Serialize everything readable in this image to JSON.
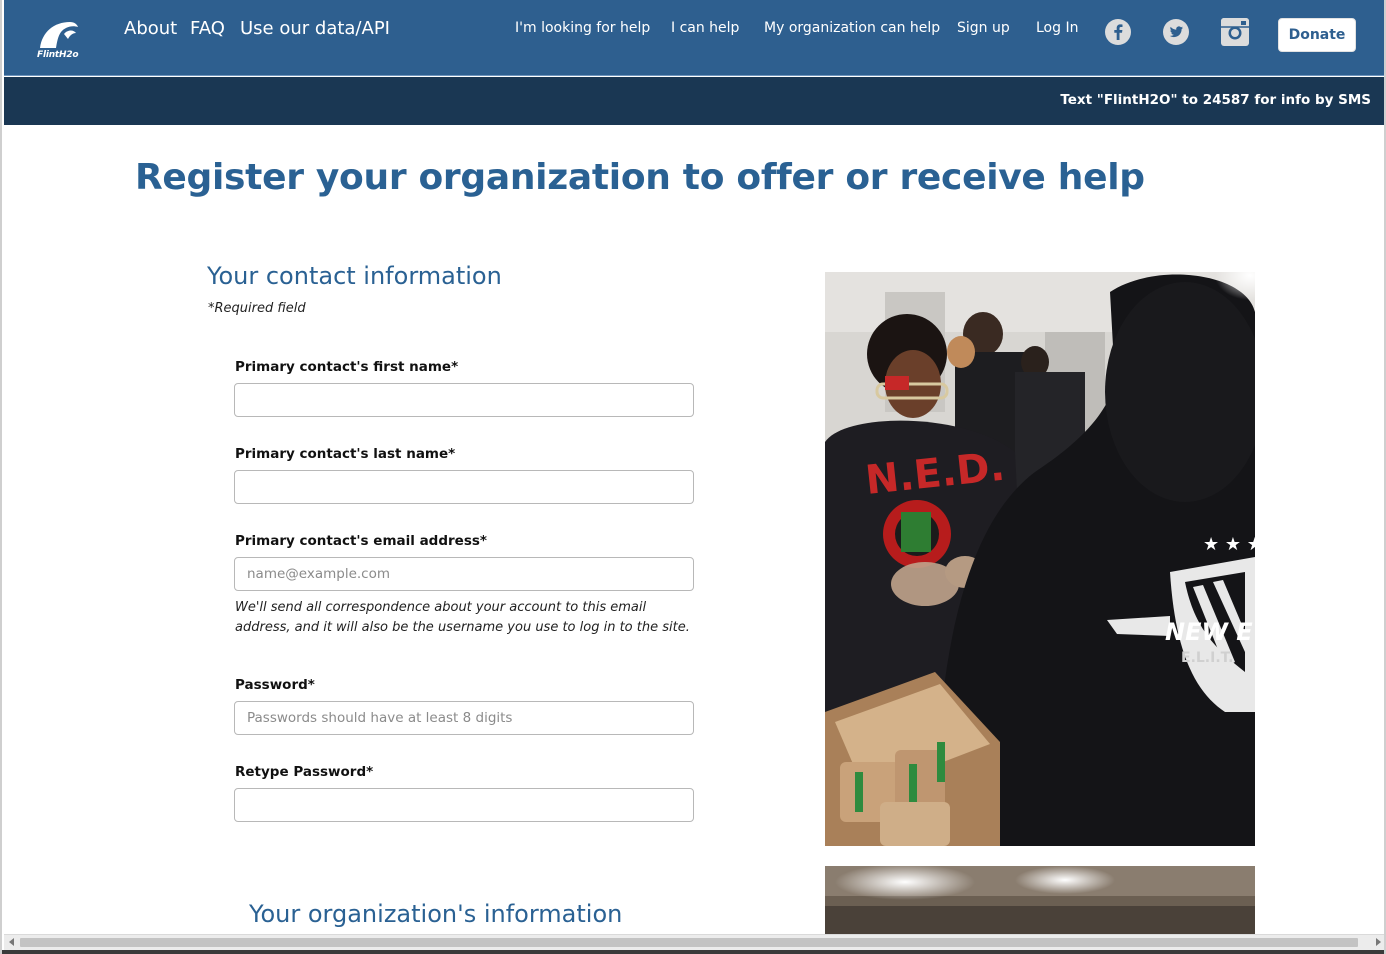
{
  "nav": {
    "logo_text": "FlintH2o",
    "left_links": [
      "About",
      "FAQ",
      "Use our data/API"
    ],
    "right_links": [
      "I'm looking for help",
      "I can help",
      "My organization can help",
      "Sign up",
      "Log In"
    ],
    "social_icons": [
      "facebook-icon",
      "twitter-icon",
      "instagram-icon"
    ],
    "donate_label": "Donate"
  },
  "sms_bar": {
    "text": "Text \"FlintH2O\" to 24587 for info by SMS"
  },
  "page": {
    "title": "Register your organization to offer or receive help"
  },
  "contact_section": {
    "heading": "Your contact information",
    "required_note": "*Required field",
    "fields": [
      {
        "label": "Primary contact's first name*",
        "placeholder": "",
        "value": ""
      },
      {
        "label": "Primary contact's last name*",
        "placeholder": "",
        "value": ""
      },
      {
        "label": "Primary contact's email address*",
        "placeholder": "name@example.com",
        "value": ""
      },
      {
        "label": "Password*",
        "placeholder": "Passwords should have at least 8 digits",
        "value": ""
      },
      {
        "label": "Retype Password*",
        "placeholder": "",
        "value": ""
      }
    ],
    "email_help": "We'll send all correspondence about your account to this email address, and it will also be the username you use to log in to the site."
  },
  "org_section": {
    "heading": "Your organization's information"
  },
  "photos": {
    "photo1_shirt_text": "N.E.D.",
    "photo1_logo_text": "NEW E",
    "photo1_logo_subtext": "E.L.I.T."
  },
  "colors": {
    "nav_bg": "#2e5f8f",
    "sms_bg": "#1a3753",
    "heading": "#2a6193"
  }
}
